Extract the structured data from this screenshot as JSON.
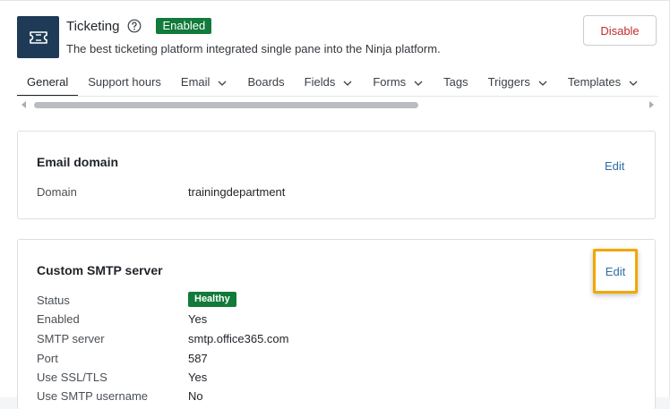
{
  "header": {
    "title": "Ticketing",
    "status_badge": "Enabled",
    "description": "The best ticketing platform integrated single pane into the Ninja platform.",
    "disable_label": "Disable"
  },
  "tabs": [
    {
      "label": "General",
      "active": true,
      "has_dropdown": false
    },
    {
      "label": "Support hours",
      "active": false,
      "has_dropdown": false
    },
    {
      "label": "Email",
      "active": false,
      "has_dropdown": true
    },
    {
      "label": "Boards",
      "active": false,
      "has_dropdown": false
    },
    {
      "label": "Fields",
      "active": false,
      "has_dropdown": true
    },
    {
      "label": "Forms",
      "active": false,
      "has_dropdown": true
    },
    {
      "label": "Tags",
      "active": false,
      "has_dropdown": false
    },
    {
      "label": "Triggers",
      "active": false,
      "has_dropdown": true
    },
    {
      "label": "Templates",
      "active": false,
      "has_dropdown": true
    }
  ],
  "email_domain": {
    "title": "Email domain",
    "edit_label": "Edit",
    "domain_label": "Domain",
    "domain_value": "trainingdepartment"
  },
  "smtp": {
    "title": "Custom SMTP server",
    "edit_label": "Edit",
    "status_label": "Status",
    "status_value": "Healthy",
    "rows": [
      {
        "label": "Enabled",
        "value": "Yes"
      },
      {
        "label": "SMTP server",
        "value": "smtp.office365.com"
      },
      {
        "label": "Port",
        "value": "587"
      },
      {
        "label": "Use SSL/TLS",
        "value": "Yes"
      },
      {
        "label": "Use SMTP username",
        "value": "No"
      }
    ]
  },
  "colors": {
    "brand_dark": "#1e3a57",
    "success": "#127a3a",
    "danger": "#c42b2b",
    "link": "#2e6ea6",
    "highlight": "#f0a800"
  },
  "icons": {
    "app": "ticket-icon",
    "help": "question-circle-icon",
    "dropdown": "chevron-down-icon"
  }
}
